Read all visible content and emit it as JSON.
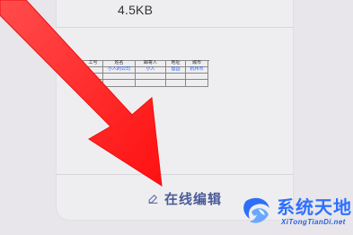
{
  "file": {
    "size": "4.5KB"
  },
  "preview": {
    "headers": [
      "工号",
      "姓名",
      "邮寄人",
      "地址",
      "城市"
    ],
    "row1": [
      "",
      "小人的公司",
      "小人",
      "留园",
      "杭州市"
    ]
  },
  "actions": {
    "online_edit": "在线编辑"
  },
  "watermark": {
    "title": "系统天地",
    "subtitle": "XiTongTianDi.net"
  },
  "colors": {
    "arrow": "#ff1b1b",
    "action_text": "#4b5b98",
    "watermark_blue": "#2e70ff"
  },
  "icons": {
    "edit": "edit-icon",
    "logo": "watermark-logo-icon"
  }
}
